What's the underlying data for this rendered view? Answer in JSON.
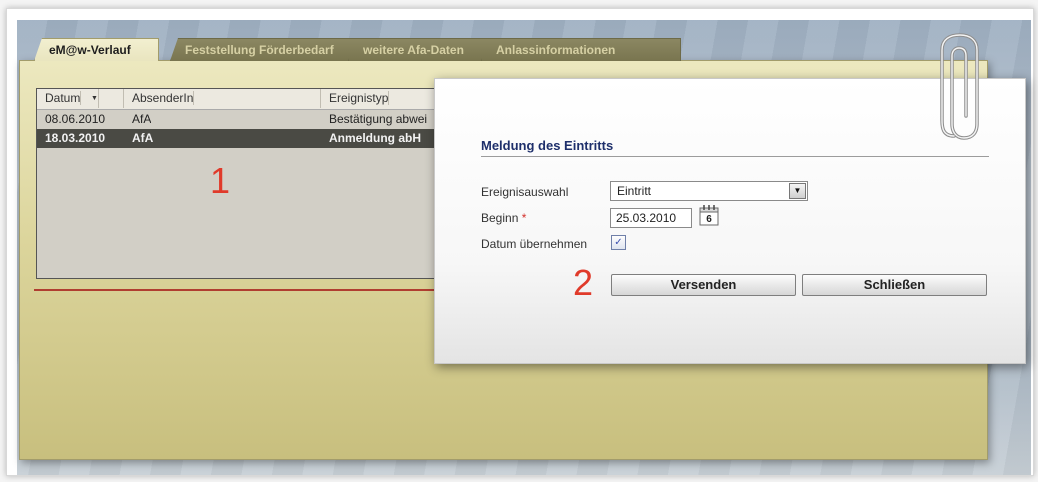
{
  "tabs": [
    {
      "label": "eM@w-Verlauf",
      "active": true
    },
    {
      "label": "Feststellung Förderbedarf",
      "active": false
    },
    {
      "label": "weitere Afa-Daten",
      "active": false
    },
    {
      "label": "Anlassinformationen",
      "active": false
    }
  ],
  "grid": {
    "columns": [
      "Datum",
      "AbsenderIn",
      "Ereignistyp"
    ],
    "rows": [
      {
        "datum": "08.06.2010",
        "absender": "AfA",
        "ereignis": "Bestätigung abwei",
        "selected": false
      },
      {
        "datum": "18.03.2010",
        "absender": "AfA",
        "ereignis": "Anmeldung abH",
        "selected": true
      }
    ]
  },
  "markers": {
    "one": "1",
    "two": "2"
  },
  "dialog": {
    "title": "Meldung des Eintritts",
    "ereignisauswahl_label": "Ereignisauswahl",
    "ereignisauswahl_value": "Eintritt",
    "beginn_label": "Beginn",
    "beginn_required": "*",
    "beginn_value": "25.03.2010",
    "calendar_day": "6",
    "datum_label": "Datum übernehmen",
    "datum_checked": true,
    "send_label": "Versenden",
    "close_label": "Schließen"
  },
  "colors": {
    "accent_title": "#1e2f6b",
    "marker": "#e03a2a",
    "selected_row": "#4a4a44",
    "panel": "#dcd59c"
  }
}
